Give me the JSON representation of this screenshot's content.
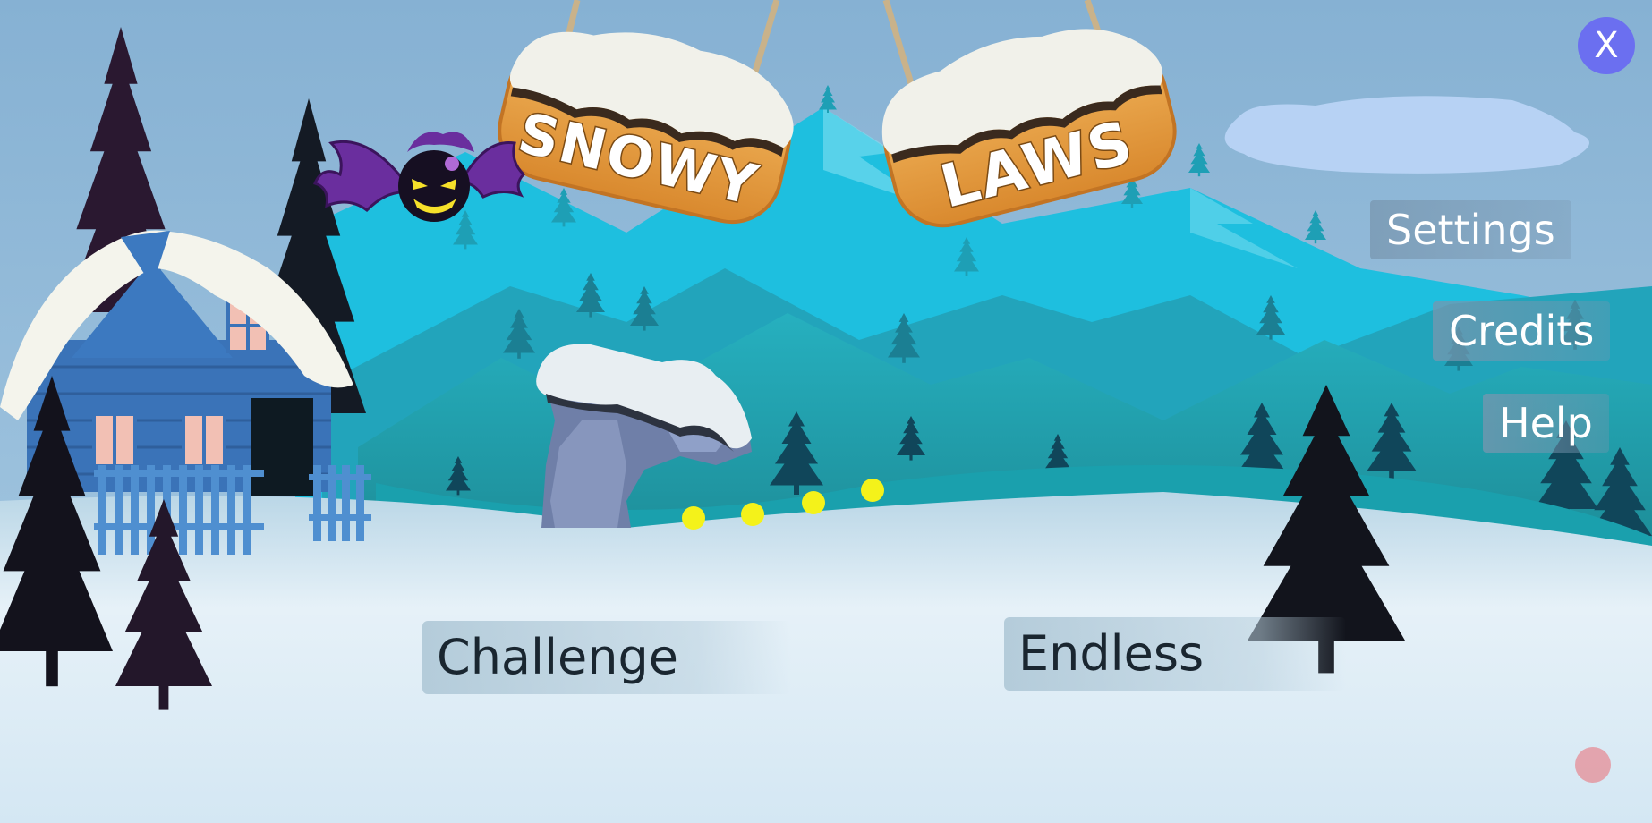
{
  "game": {
    "title_words": [
      "SNOWY",
      "LAWS"
    ]
  },
  "menu": {
    "settings": "Settings",
    "credits": "Credits",
    "help": "Help"
  },
  "modes": {
    "challenge": "Challenge",
    "endless": "Endless"
  },
  "close": {
    "label": "X"
  },
  "colors": {
    "sky": "#8db6d6",
    "mountain_light": "#1fb8d8",
    "mountain_dark": "#1f8fa0",
    "snow": "#e8f2f8",
    "sign_wood": "#e39a3c",
    "close_button": "#6b6ff0",
    "coin": "#f4f21a",
    "bat_body": "#5b2a8c"
  },
  "icons": {
    "close": "close-icon",
    "record": "record-dot-icon"
  }
}
